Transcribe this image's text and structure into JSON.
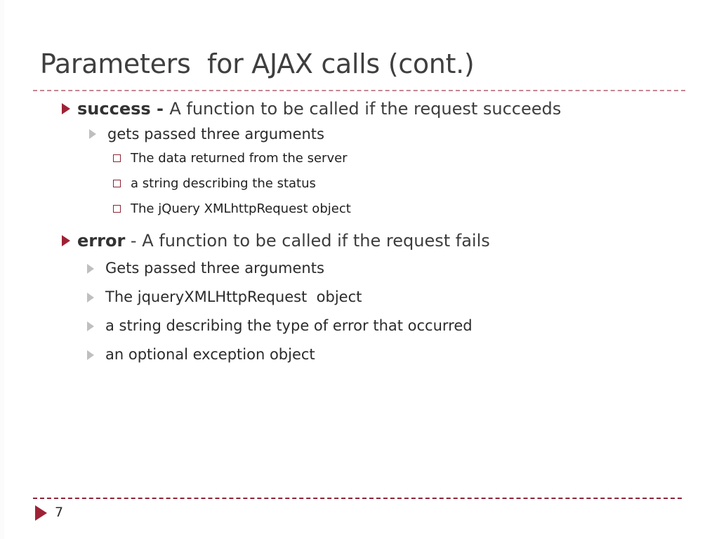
{
  "slide": {
    "title": "Parameters  for AJAX calls (cont.)",
    "background_color": "#ffffff",
    "accent_color": "#9e2235",
    "rule_color": "#8d2437",
    "title_rule_color": "#b9707f",
    "body_text_color": "#3d3d3d"
  },
  "content": [
    {
      "level": 1,
      "marker": "red-triangle-bullet",
      "lead": "success - ",
      "text": "A function to be called if the request succeeds"
    },
    {
      "level": 2,
      "marker": "gray-triangle-bullet",
      "text": "gets passed three arguments"
    },
    {
      "level": 3,
      "marker": "hollow-square-bullet",
      "text": "The data returned from the server"
    },
    {
      "level": 3,
      "marker": "hollow-square-bullet",
      "text": "a string describing the status"
    },
    {
      "level": 3,
      "marker": "hollow-square-bullet",
      "text": "The jQuery XMLhttpRequest object"
    },
    {
      "level": 1,
      "marker": "red-triangle-bullet",
      "lead": "error",
      "text": " - A function to be called if the request fails"
    },
    {
      "level": 2,
      "marker": "gray-triangle-bullet",
      "text": "Gets passed three arguments"
    },
    {
      "level": 2,
      "marker": "gray-triangle-bullet",
      "text": "The jqueryXMLHttpRequest  object"
    },
    {
      "level": 2,
      "marker": "gray-triangle-bullet",
      "text": "a string describing the type of error that occurred"
    },
    {
      "level": 2,
      "marker": "gray-triangle-bullet",
      "text": "an optional exception object"
    }
  ],
  "footer": {
    "marker": "red-triangle-marker",
    "slide_number": "7"
  }
}
